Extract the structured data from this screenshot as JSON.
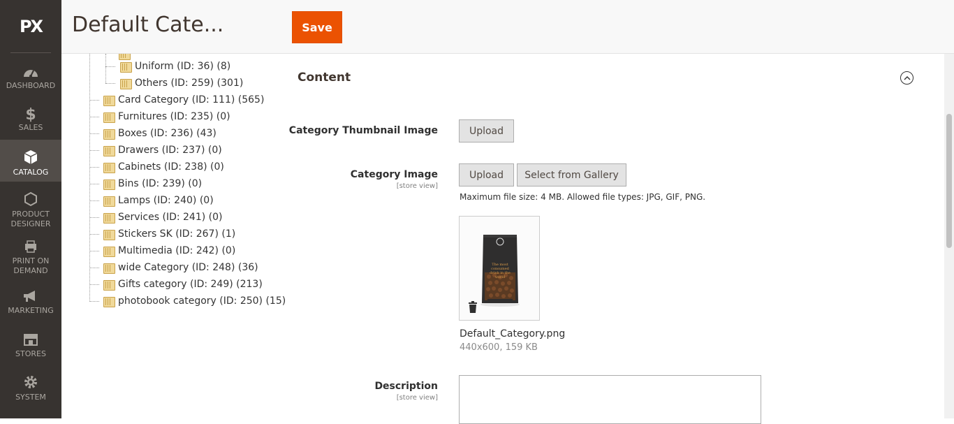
{
  "sidebar": {
    "logo": "PX",
    "items": [
      {
        "label": "DASHBOARD",
        "icon": "dashboard-icon"
      },
      {
        "label": "SALES",
        "icon": "dollar-icon"
      },
      {
        "label": "CATALOG",
        "icon": "box-icon",
        "active": true
      },
      {
        "label_line1": "PRODUCT",
        "label_line2": "DESIGNER",
        "icon": "hexagon-icon"
      },
      {
        "label_line1": "PRINT ON",
        "label_line2": "DEMAND",
        "icon": "printer-icon"
      },
      {
        "label": "MARKETING",
        "icon": "megaphone-icon"
      },
      {
        "label": "STORES",
        "icon": "store-icon"
      },
      {
        "label": "SYSTEM",
        "icon": "gear-icon"
      }
    ]
  },
  "header": {
    "title": "Default Cate...",
    "save_label": "Save"
  },
  "tree": {
    "items": [
      {
        "label": "Uniform (ID: 36) (8)"
      },
      {
        "label": "Others (ID: 259) (301)"
      },
      {
        "label": "Card Category (ID: 111) (565)"
      },
      {
        "label": "Furnitures (ID: 235) (0)"
      },
      {
        "label": "Boxes (ID: 236) (43)"
      },
      {
        "label": "Drawers (ID: 237) (0)"
      },
      {
        "label": "Cabinets (ID: 238) (0)"
      },
      {
        "label": "Bins (ID: 239) (0)"
      },
      {
        "label": "Lamps (ID: 240) (0)"
      },
      {
        "label": "Services (ID: 241) (0)"
      },
      {
        "label": "Stickers SK (ID: 267) (1)"
      },
      {
        "label": "Multimedia (ID: 242) (0)"
      },
      {
        "label": "wide Category (ID: 248) (36)"
      },
      {
        "label": "Gifts category (ID: 249) (213)"
      },
      {
        "label": "photobook category (ID: 250) (15)"
      }
    ]
  },
  "content": {
    "section_title": "Content",
    "thumbnail_label": "Category Thumbnail Image",
    "upload_label": "Upload",
    "image_label": "Category Image",
    "store_view": "[store view]",
    "gallery_label": "Select from Gallery",
    "file_note": "Maximum file size: 4 MB. Allowed file types: JPG, GIF, PNG.",
    "file_name": "Default_Category.png",
    "file_meta": "440x600, 159 KB",
    "description_label": "Description",
    "bag_text": "The most consumed drink in the world"
  },
  "colors": {
    "sidebar_bg": "#373330",
    "save_btn": "#eb5202"
  }
}
